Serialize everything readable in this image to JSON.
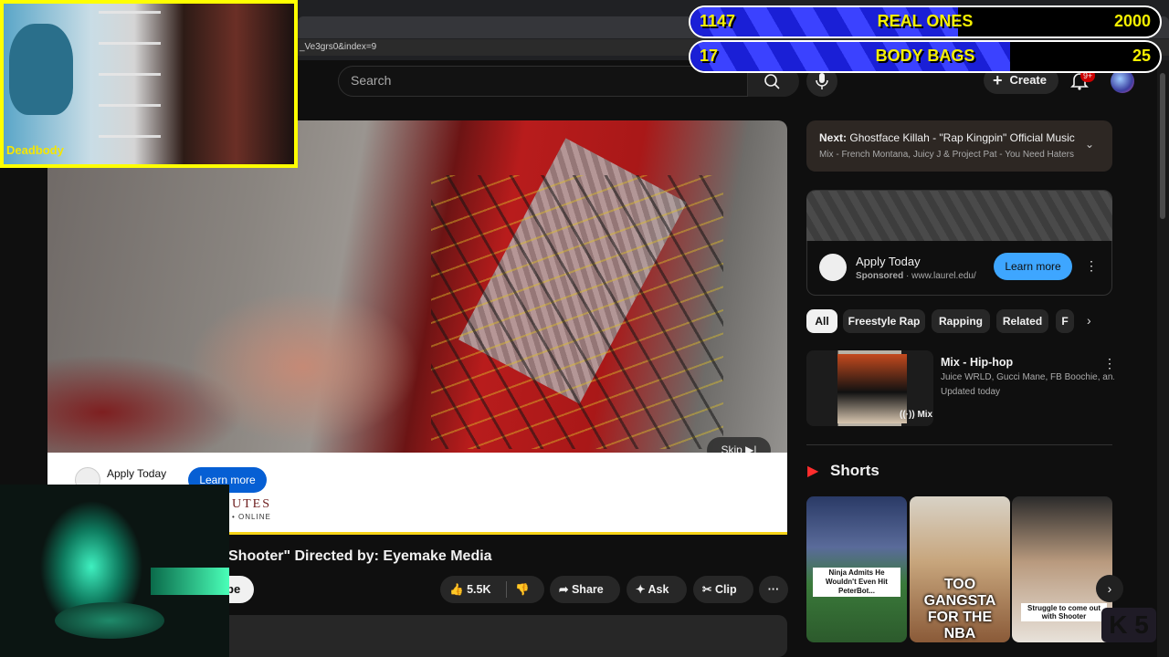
{
  "browser": {
    "url_fragment": "_Ve3grs0&index=9"
  },
  "header": {
    "search_placeholder": "Search",
    "create_label": "Create",
    "notification_count": "9+"
  },
  "player": {
    "skip_label": "Skip",
    "ad": {
      "title": "Apply Today",
      "cta": "Learn more",
      "brand_text": "UTES",
      "brand_sub": "• ONLINE"
    }
  },
  "video": {
    "title": "Shooter\" Directed by: Eyemake Media",
    "subscribe_partial": "be",
    "likes": "5.5K",
    "share_label": "Share",
    "ask_label": "Ask",
    "clip_label": "Clip"
  },
  "sidebar": {
    "next": {
      "prefix": "Next:",
      "title": "Ghostface Killah - \"Rap Kingpin\" Official Music...",
      "subtitle": "Mix - French Montana, Juicy J & Project Pat - You Need Haters"
    },
    "ad_card": {
      "title": "Apply Today",
      "sponsored": "Sponsored",
      "domain": "www.laurel.edu/",
      "cta": "Learn more"
    },
    "chips": [
      "All",
      "Freestyle Rap",
      "Rapping",
      "Related",
      "F"
    ],
    "mix": {
      "title": "Mix - Hip-hop",
      "artists": "Juice WRLD, Gucci Mane, FB Boochie, an...",
      "updated": "Updated today",
      "badge": "Mix"
    },
    "shorts_title": "Shorts",
    "shorts": [
      {
        "caption": "Ninja Admits He Wouldn't Even Hit PeterBot..."
      },
      {
        "caption": "TOO GANGSTA FOR THE NBA"
      },
      {
        "caption": "Struggle to come out with Shooter"
      }
    ]
  },
  "overlay": {
    "webcam_tag": "Deadbody",
    "bars": [
      {
        "left": "1147",
        "label": "REAL ONES",
        "right": "2000",
        "progress": 0.57
      },
      {
        "left": "17",
        "label": "BODY BAGS",
        "right": "25",
        "progress": 0.68
      }
    ],
    "corner_logo": "K 5"
  }
}
